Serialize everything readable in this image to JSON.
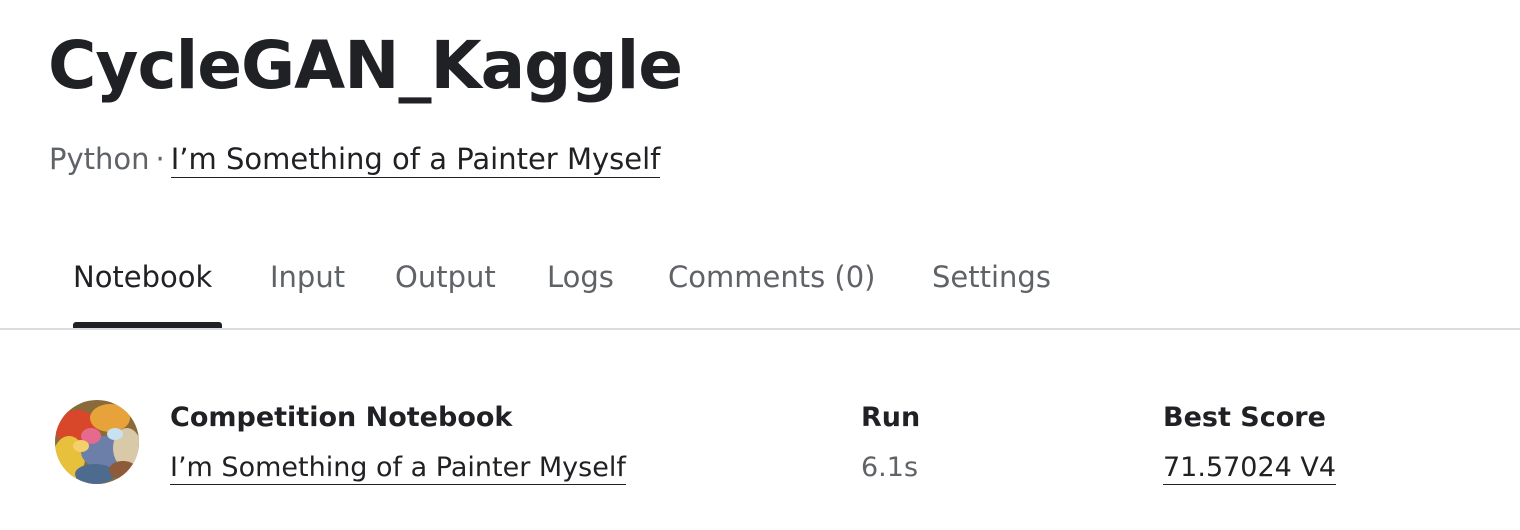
{
  "header": {
    "title": "CycleGAN_Kaggle",
    "language": "Python",
    "separator": "·",
    "competition_link": "I’m Something of a Painter Myself"
  },
  "tabs": [
    {
      "label": "Notebook",
      "active": true
    },
    {
      "label": "Input",
      "active": false
    },
    {
      "label": "Output",
      "active": false
    },
    {
      "label": "Logs",
      "active": false
    },
    {
      "label": "Comments (0)",
      "active": false
    },
    {
      "label": "Settings",
      "active": false
    }
  ],
  "info": {
    "avatar_icon": "competition-painting-avatar",
    "competition_label": "Competition Notebook",
    "competition_value": "I’m Something of a Painter Myself",
    "run_label": "Run",
    "run_value": "6.1s",
    "score_label": "Best Score",
    "score_value": "71.57024 V4"
  },
  "colors": {
    "text_primary": "#202124",
    "text_secondary": "#5f6368",
    "divider": "#dadce0"
  }
}
